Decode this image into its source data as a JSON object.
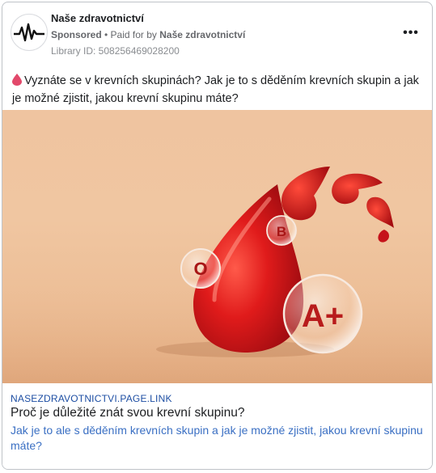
{
  "post": {
    "page_name": "Naše zdravotnictví",
    "sponsored": "Sponsored",
    "paid_for_prefix": "• Paid for by",
    "paid_for_name": "Naše zdravotnictví",
    "library_id": "Library ID: 508256469028200",
    "more_label": "•••",
    "body_text": "Vyznáte se v krevních skupinách? Jak je to s děděním krevních skupin a jak je možné zjistit, jakou krevní skupinu máte?"
  },
  "image": {
    "bubble_labels": [
      "O",
      "B",
      "A+"
    ]
  },
  "link": {
    "domain": "NASEZDRAVOTNICTVI.PAGE.LINK",
    "title": "Proč je důležité znát svou krevní skupinu?",
    "description": "Jak je to ale s děděním krevních skupin a jak je možné zjistit, jakou krevní skupinu máte?"
  },
  "colors": {
    "link_blue": "#1d4ea3",
    "desc_blue": "#3a6fc3",
    "blood_red": "#d4141b",
    "background_peach": "#efc4a0"
  }
}
